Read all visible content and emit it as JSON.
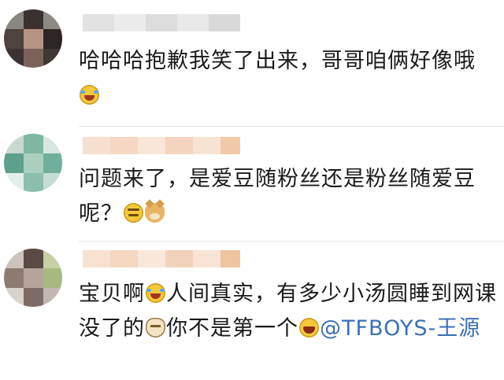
{
  "colors": {
    "background": "#ffffff",
    "text": "#1a1a1a",
    "mention": "#3b6fb6",
    "divider": "#e6e6e6"
  },
  "comments": [
    {
      "text_part1": "哈哈哈抱歉我笑了出来，哥哥咱俩好像哦",
      "emoji_after_part1": "laugh-cry-emoji"
    },
    {
      "text_part1": "问题来了，是爱豆随粉丝还是粉丝随爱豆呢？",
      "emoji_after_part1": "smirk-emoji",
      "emoji_2": "doge-emoji"
    },
    {
      "text_part1": "宝贝啊",
      "emoji_after_part1": "laugh-cry-emoji",
      "text_part2": "人间真实，有多少小汤圆睡到网课没了的",
      "emoji_after_part2": "cat-emoji",
      "text_part3": "你不是第一个",
      "emoji_after_part3": "grin-emoji",
      "mention": "@TFBOYS-王源"
    }
  ]
}
